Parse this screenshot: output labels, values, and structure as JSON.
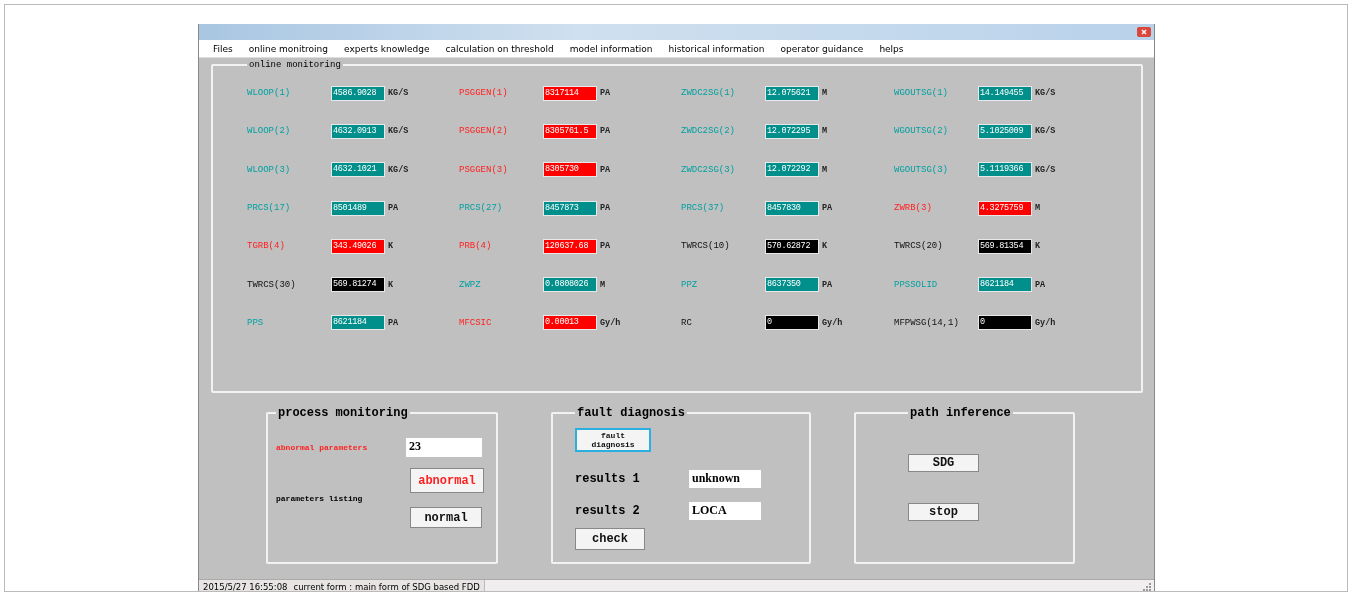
{
  "menu": [
    "Files",
    "online monitroing",
    "experts knowledge",
    "calculation on threshold",
    "model information",
    "historical information",
    "operator guidance",
    "helps"
  ],
  "online_monitoring": {
    "title": "online monitoring",
    "parameters": [
      {
        "name": "WLOOP(1)",
        "value": "4586.9028",
        "unit": "KG/S",
        "kind": "normal"
      },
      {
        "name": "PSGGEN(1)",
        "value": "8317114",
        "unit": "PA",
        "kind": "alarm"
      },
      {
        "name": "ZWDC2SG(1)",
        "value": "12.075621",
        "unit": "M",
        "kind": "normal"
      },
      {
        "name": "WGOUTSG(1)",
        "value": "14.149455",
        "unit": "KG/S",
        "kind": "normal"
      },
      {
        "name": "WLOOP(2)",
        "value": "4632.0913",
        "unit": "KG/S",
        "kind": "normal"
      },
      {
        "name": "PSGGEN(2)",
        "value": "8305761.5",
        "unit": "PA",
        "kind": "alarm"
      },
      {
        "name": "ZWDC2SG(2)",
        "value": "12.072295",
        "unit": "M",
        "kind": "normal"
      },
      {
        "name": "WGOUTSG(2)",
        "value": "5.1025009",
        "unit": "KG/S",
        "kind": "normal"
      },
      {
        "name": "WLOOP(3)",
        "value": "4632.1021",
        "unit": "KG/S",
        "kind": "normal"
      },
      {
        "name": "PSGGEN(3)",
        "value": "8305730",
        "unit": "PA",
        "kind": "alarm"
      },
      {
        "name": "ZWDC2SG(3)",
        "value": "12.072292",
        "unit": "M",
        "kind": "normal"
      },
      {
        "name": "WGOUTSG(3)",
        "value": "5.1119366",
        "unit": "KG/S",
        "kind": "normal"
      },
      {
        "name": "PRCS(17)",
        "value": "8501489",
        "unit": "PA",
        "kind": "normal"
      },
      {
        "name": "PRCS(27)",
        "value": "8457873",
        "unit": "PA",
        "kind": "normal"
      },
      {
        "name": "PRCS(37)",
        "value": "8457830",
        "unit": "PA",
        "kind": "normal"
      },
      {
        "name": "ZWRB(3)",
        "value": "4.3275759",
        "unit": "M",
        "kind": "alarm"
      },
      {
        "name": "TGRB(4)",
        "value": "343.49026",
        "unit": "K",
        "kind": "alarm"
      },
      {
        "name": "PRB(4)",
        "value": "120637.68",
        "unit": "PA",
        "kind": "alarm"
      },
      {
        "name": "TWRCS(10)",
        "value": "570.62872",
        "unit": "K",
        "kind": "inactive"
      },
      {
        "name": "TWRCS(20)",
        "value": "569.81354",
        "unit": "K",
        "kind": "inactive"
      },
      {
        "name": "TWRCS(30)",
        "value": "569.81274",
        "unit": "K",
        "kind": "inactive"
      },
      {
        "name": "ZWPZ",
        "value": "0.0808026",
        "unit": "M",
        "kind": "normal"
      },
      {
        "name": "PPZ",
        "value": "8637350",
        "unit": "PA",
        "kind": "normal"
      },
      {
        "name": "PPSSOLID",
        "value": "8621184",
        "unit": "PA",
        "kind": "normal"
      },
      {
        "name": "PPS",
        "value": "8621184",
        "unit": "PA",
        "kind": "normal"
      },
      {
        "name": "MFCSIC",
        "value": "0.00013",
        "unit": "Gy/h",
        "kind": "alarm"
      },
      {
        "name": "RC",
        "value": "0",
        "unit": "Gy/h",
        "kind": "inactive"
      },
      {
        "name": "MFPWSG(14,1)",
        "value": "0",
        "unit": "Gy/h",
        "kind": "inactive"
      }
    ]
  },
  "process_monitoring": {
    "title": "process monitoring",
    "abnormal_label": "abnormal parameters",
    "abnormal_count": "23",
    "listing_label": "parameters listing",
    "buttons": [
      {
        "label": "abnormal",
        "kind": "abnormal"
      },
      {
        "label": "normal",
        "kind": "normal"
      }
    ]
  },
  "fault_diagnosis": {
    "title": "fault diagnosis",
    "button": {
      "label": "fault diagnosis",
      "focused": true
    },
    "results": [
      {
        "label": "results 1",
        "value": "unknown"
      },
      {
        "label": "results 2",
        "value": "LOCA"
      }
    ],
    "check": "check"
  },
  "path_inference": {
    "title": "path inference",
    "buttons": [
      "SDG",
      "stop"
    ]
  },
  "status_bar": {
    "time": "2015/5/27 16:55:08",
    "form": "current form : main form of SDG based FDD"
  }
}
